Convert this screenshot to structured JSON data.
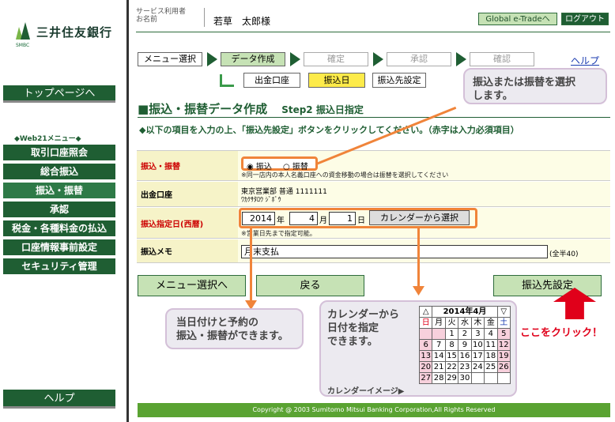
{
  "sidebar": {
    "logo_text": "三井住友銀行",
    "logo_sub": "SMBC",
    "top_page": "トップページへ",
    "menu_heading": "◆Web21メニュー◆",
    "items": [
      {
        "label": "取引口座照会"
      },
      {
        "label": "総合振込"
      },
      {
        "label": "振込・振替"
      },
      {
        "label": "承認"
      },
      {
        "label": "税金・各種料金の払込"
      },
      {
        "label": "口座情報事前設定"
      },
      {
        "label": "セキュリティ管理"
      }
    ],
    "help": "ヘルプ"
  },
  "header": {
    "user_label_1": "サービス利用者",
    "user_label_2": "お名前",
    "user_name": "若草　太郎様",
    "global_btn": "Global e-Tradeへ",
    "logout_btn": "ログアウト"
  },
  "steps": [
    "メニュー選択",
    "データ作成",
    "確定",
    "承認",
    "確認"
  ],
  "help_link": "ヘルプ",
  "subtabs": [
    "出金口座",
    "振込日",
    "振込先設定"
  ],
  "title": "■振込・振替データ作成",
  "step_title": "Step2 振込日指定",
  "instruction": "◆以下の項目を入力の上、「振込先設定」ボタンをクリックしてください。（赤字は入力必須項目）",
  "form": {
    "type_label": "振込・振替",
    "radio_furikomi": "振込",
    "radio_furikae": "振替",
    "type_note": "※同一店内の本人名義口座への資金移動の場合は振替を選択してください",
    "account_label": "出金口座",
    "account_line1": "東京営業部 普通 1111111",
    "account_line2": "ﾜｶｸｻﾀﾛｳ ｼﾞﾎﾞｳ",
    "date_label": "振込指定日(西暦)",
    "year": "2014",
    "year_unit": "年",
    "month": "4",
    "month_unit": "月",
    "day": "1",
    "day_unit": "日",
    "calendar_btn": "カレンダーから選択",
    "date_note": "※営業日先まで指定可能。",
    "memo_label": "振込メモ",
    "memo_value": "月末支払",
    "memo_note": "(全半40)"
  },
  "buttons": {
    "menu": "メニュー選択へ",
    "back": "戻る",
    "next": "振込先設定"
  },
  "callouts": {
    "select_text_1": "振込または振替を選択",
    "select_text_2": "します。",
    "reserve_text_1": "当日付けと予約の",
    "reserve_text_2": "振込・振替ができます。",
    "calendar_text_1": "カレンダーから",
    "calendar_text_2": "日付を指定",
    "calendar_text_3": "できます。",
    "calendar_image": "カレンダーイメージ▶",
    "click_here": "ここをクリック！"
  },
  "calendar": {
    "prev": "△",
    "month_title": "2014年4月",
    "next": "▽",
    "weekdays": [
      "日",
      "月",
      "火",
      "水",
      "木",
      "金",
      "土"
    ],
    "weeks": [
      [
        "",
        "",
        "1",
        "2",
        "3",
        "4",
        "5"
      ],
      [
        "6",
        "7",
        "8",
        "9",
        "10",
        "11",
        "12"
      ],
      [
        "13",
        "14",
        "15",
        "16",
        "17",
        "18",
        "19"
      ],
      [
        "20",
        "21",
        "22",
        "23",
        "24",
        "25",
        "26"
      ],
      [
        "27",
        "28",
        "29",
        "30",
        "",
        "",
        ""
      ]
    ]
  },
  "footer": "Copyright @ 2003 Sumitomo Mitsui Banking Corporation,All Rights Reserved",
  "colors": {
    "brand_green": "#1f5e33",
    "light_green": "#c6e2b5",
    "accent_orange": "#f0843a",
    "alert_red": "#e0001a"
  }
}
